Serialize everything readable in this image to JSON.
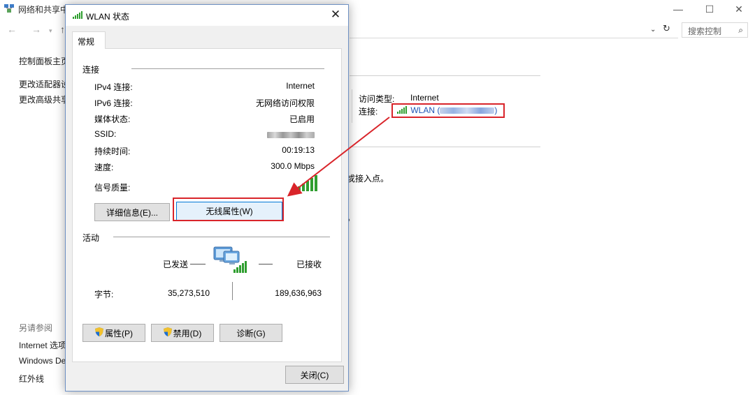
{
  "background": {
    "title": "网络和共享中",
    "window_controls": {
      "minimize": "—",
      "maximize": "☐",
      "close": "✕"
    },
    "nav": {
      "back": "←",
      "forward": "→",
      "dropdown": "▾",
      "up": "↑"
    },
    "address_dropdown": "⌄",
    "refresh": "↻",
    "search_placeholder": "搜索控制",
    "left_nav": [
      "控制面板主页",
      "更改适配器设",
      "更改高级共享"
    ],
    "see_also_title": "另请参阅",
    "see_also": [
      "Internet 选项",
      "Windows De",
      "红外线"
    ],
    "access_type_label": "访问类型:",
    "access_type_value": "Internet",
    "connection_label": "连接:",
    "connection_value_prefix": "WLAN (",
    "connection_value_suffix": ")",
    "text_fragment_1": "戓接入点。",
    "text_fragment_2": "。"
  },
  "dialog": {
    "title": "WLAN 状态",
    "close": "✕",
    "tab": "常规",
    "connection_group": "连接",
    "rows": [
      {
        "label": "IPv4 连接:",
        "value": "Internet"
      },
      {
        "label": "IPv6 连接:",
        "value": "无网络访问权限"
      },
      {
        "label": "媒体状态:",
        "value": "已启用"
      },
      {
        "label": "SSID:",
        "value": ""
      },
      {
        "label": "持续时间:",
        "value": "00:19:13"
      },
      {
        "label": "速度:",
        "value": "300.0 Mbps"
      }
    ],
    "signal_label": "信号质量:",
    "details_button": "详细信息(E)...",
    "wireless_button": "无线属性(W)",
    "activity_group": "活动",
    "sent_label": "已发送",
    "received_label": "已接收",
    "bytes_label": "字节:",
    "bytes_sent": "35,273,510",
    "bytes_received": "189,636,963",
    "properties_button": "属性(P)",
    "disable_button": "禁用(D)",
    "diagnose_button": "诊断(G)",
    "close_button": "关闭(C)"
  },
  "colors": {
    "highlight": "#d9242a",
    "link": "#1e54b5",
    "signal": "#2f9e2f",
    "dialog_border": "#6e91c4"
  }
}
